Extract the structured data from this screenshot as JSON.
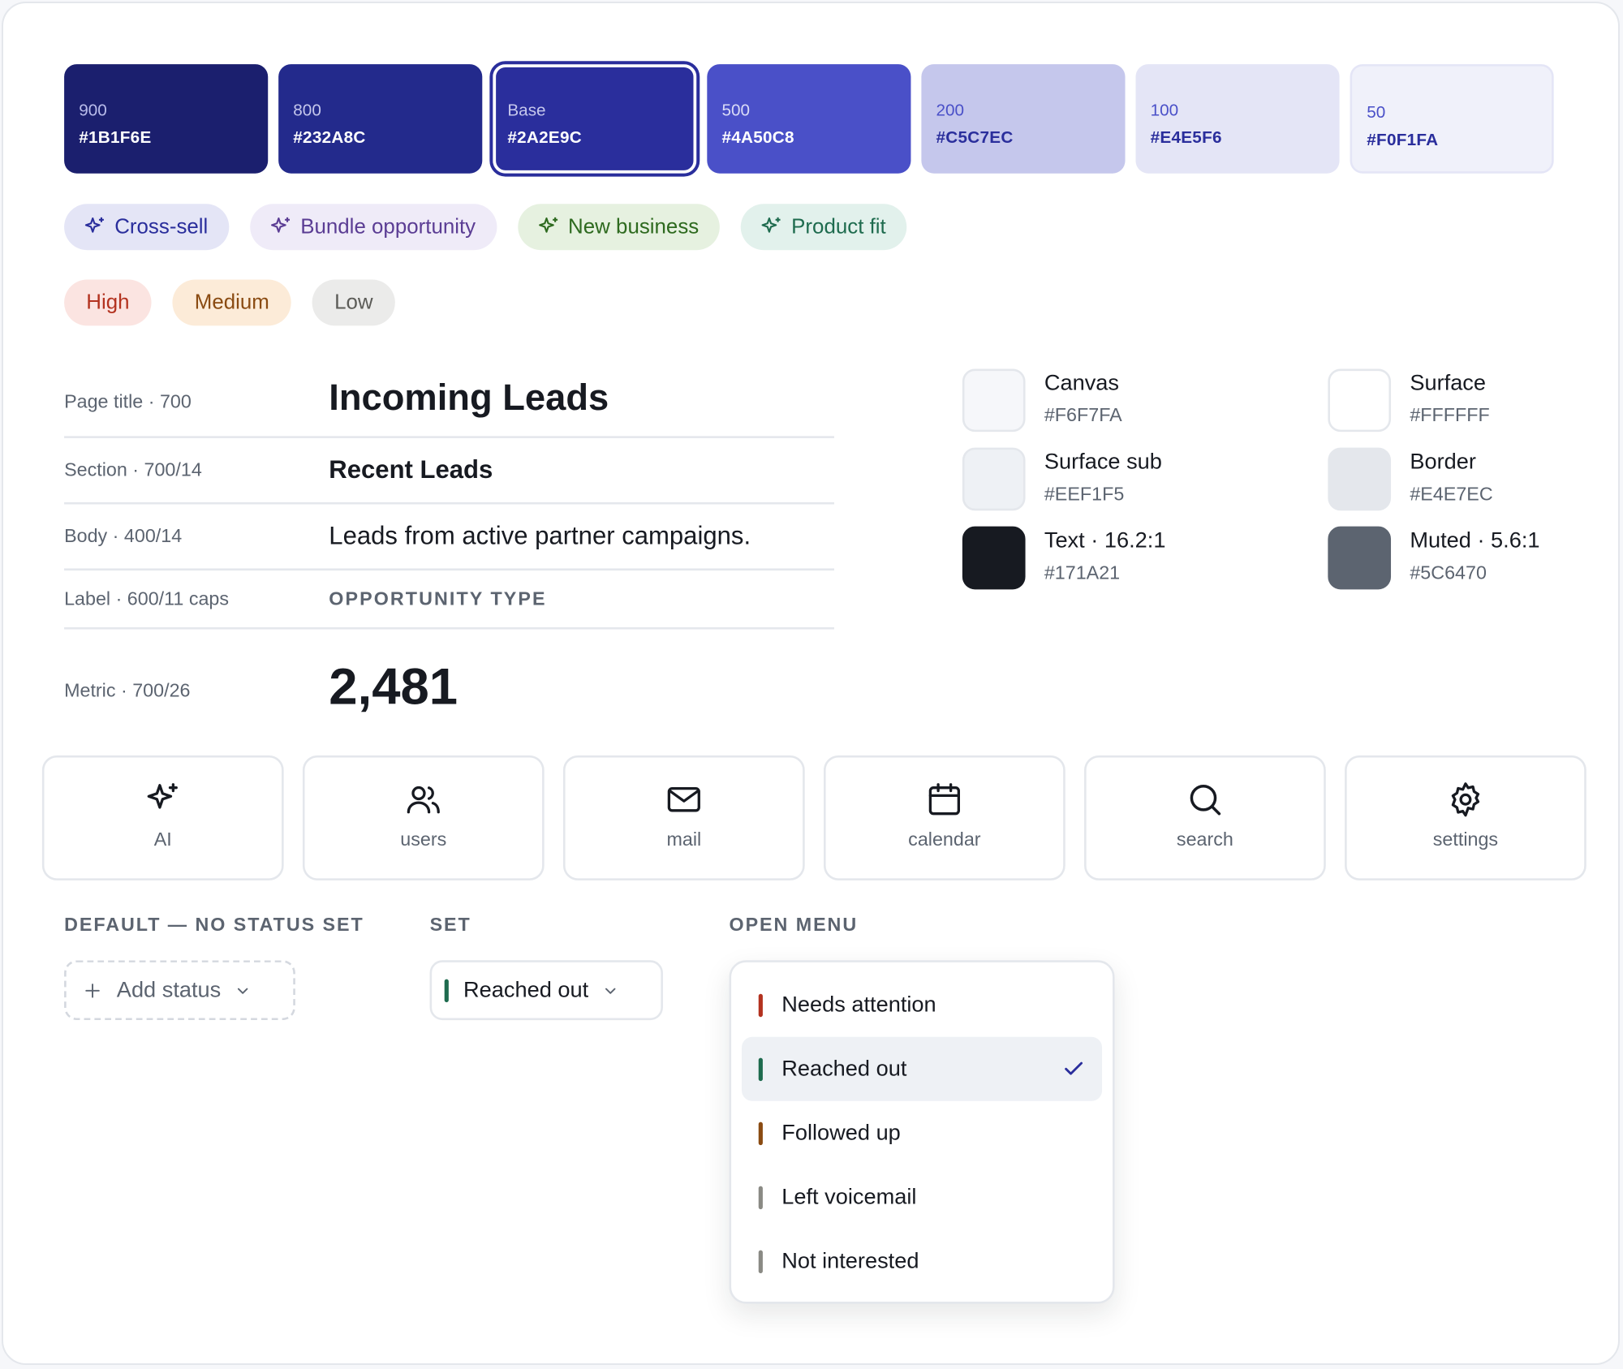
{
  "swatches": [
    {
      "label": "900",
      "hex": "#1B1F6E",
      "bg": "#1B1F6E",
      "fg_label": "#B9BCEB",
      "fg_hex": "#FFFFFF"
    },
    {
      "label": "800",
      "hex": "#232A8C",
      "bg": "#232A8C",
      "fg_label": "#C5C7EC",
      "fg_hex": "#FFFFFF"
    },
    {
      "label": "Base",
      "hex": "#2A2E9C",
      "bg": "#2A2E9C",
      "fg_label": "#C5C7EC",
      "fg_hex": "#FFFFFF",
      "selected": true
    },
    {
      "label": "500",
      "hex": "#4A50C8",
      "bg": "#4A50C8",
      "fg_label": "#DADCF7",
      "fg_hex": "#FFFFFF"
    },
    {
      "label": "200",
      "hex": "#C5C7EC",
      "bg": "#C5C7EC",
      "fg_label": "#4A50C8",
      "fg_hex": "#2A2E9C"
    },
    {
      "label": "100",
      "hex": "#E4E5F6",
      "bg": "#E4E5F6",
      "fg_label": "#4A50C8",
      "fg_hex": "#2A2E9C"
    },
    {
      "label": "50",
      "hex": "#F0F1FA",
      "bg": "#F0F1FA",
      "fg_label": "#4A50C8",
      "fg_hex": "#2A2E9C"
    }
  ],
  "opportunity_chips": [
    {
      "label": "Cross-sell",
      "bg": "#E4E5F6",
      "fg": "#2A2E9C"
    },
    {
      "label": "Bundle opportunity",
      "bg": "#EFEBF8",
      "fg": "#5B3D94"
    },
    {
      "label": "New business",
      "bg": "#E6F1E0",
      "fg": "#2E6A1F"
    },
    {
      "label": "Product fit",
      "bg": "#E2F1EC",
      "fg": "#1E6B4E"
    }
  ],
  "priority_chips": [
    {
      "label": "High",
      "bg": "#FBE4E1",
      "fg": "#B3321F"
    },
    {
      "label": "Medium",
      "bg": "#FCEBD8",
      "fg": "#8A4B12"
    },
    {
      "label": "Low",
      "bg": "#EBEBEA",
      "fg": "#5C5C58"
    }
  ],
  "typography": [
    {
      "key": "Page title · 700",
      "sample": "Incoming Leads"
    },
    {
      "key": "Section · 700/14",
      "sample": "Recent Leads"
    },
    {
      "key": "Body · 400/14",
      "sample": "Leads from active partner campaigns."
    },
    {
      "key": "Label · 600/11 caps",
      "sample": "OPPORTUNITY TYPE"
    },
    {
      "key": "Metric · 700/26",
      "sample": "2,481"
    }
  ],
  "neutrals": [
    {
      "name": "Canvas",
      "hex": "#F6F7FA",
      "color": "#F6F7FA"
    },
    {
      "name": "Surface",
      "hex": "#FFFFFF",
      "color": "#FFFFFF"
    },
    {
      "name": "Surface sub",
      "hex": "#EEF1F5",
      "color": "#EEF1F5"
    },
    {
      "name": "Border",
      "hex": "#E4E7EC",
      "color": "#E4E7EC"
    },
    {
      "name": "Text · 16.2:1",
      "hex": "#171A21",
      "color": "#171A21"
    },
    {
      "name": "Muted · 5.6:1",
      "hex": "#5C6470",
      "color": "#5C6470"
    }
  ],
  "icon_tiles": [
    {
      "label": "AI",
      "icon": "sparkle-icon"
    },
    {
      "label": "users",
      "icon": "users-icon"
    },
    {
      "label": "mail",
      "icon": "mail-icon"
    },
    {
      "label": "calendar",
      "icon": "calendar-icon"
    },
    {
      "label": "search",
      "icon": "search-icon"
    },
    {
      "label": "settings",
      "icon": "gear-icon"
    }
  ],
  "status": {
    "default_heading": "DEFAULT — NO STATUS SET",
    "set_heading": "SET",
    "open_heading": "OPEN MENU",
    "add_label": "Add status",
    "set_value": "Reached out",
    "set_color": "#1E6B4E",
    "menu_items": [
      {
        "label": "Needs attention",
        "color": "#B3321F",
        "selected": false
      },
      {
        "label": "Reached out",
        "color": "#1E6B4E",
        "selected": true
      },
      {
        "label": "Followed up",
        "color": "#8A4B12",
        "selected": false
      },
      {
        "label": "Left voicemail",
        "color": "#8A8A84",
        "selected": false
      },
      {
        "label": "Not interested",
        "color": "#8A8A84",
        "selected": false
      }
    ]
  }
}
